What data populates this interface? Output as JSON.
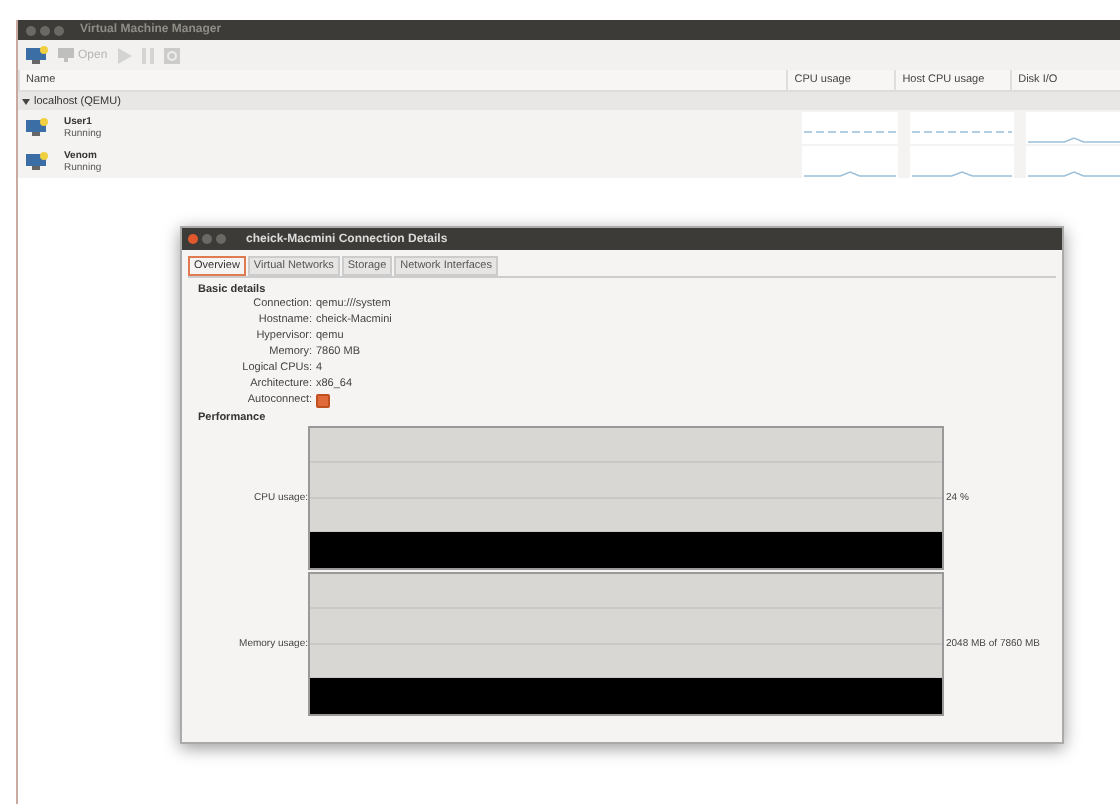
{
  "window": {
    "title": "Virtual Machine Manager"
  },
  "toolbar": [
    {
      "kind": "new",
      "disabled": false
    },
    {
      "kind": "open",
      "label": "Open",
      "disabled": true
    },
    {
      "kind": "run",
      "disabled": true
    },
    {
      "kind": "pause",
      "disabled": true
    },
    {
      "kind": "shutdown",
      "disabled": true
    }
  ],
  "columns": [
    "Name",
    "CPU usage",
    "Host CPU usage",
    "Disk I/O"
  ],
  "groups": [
    {
      "name": "localhost (QEMU)",
      "expanded": true,
      "vms": [
        {
          "name": "User1",
          "status": "Running"
        },
        {
          "name": "Venom",
          "status": "Running"
        }
      ]
    }
  ],
  "dialog": {
    "title": "cheick-Macmini Connection Details",
    "tabs": [
      {
        "label": "Overview",
        "selected": true
      },
      {
        "label": "Virtual Networks",
        "selected": false
      },
      {
        "label": "Storage",
        "selected": false
      },
      {
        "label": "Network Interfaces",
        "selected": false
      }
    ],
    "basic_title": "Basic details",
    "fields": [
      {
        "label": "Connection:",
        "value": "qemu:///system"
      },
      {
        "label": "Hostname:",
        "value": "cheick-Macmini"
      },
      {
        "label": "Hypervisor:",
        "value": "qemu"
      },
      {
        "label": "Memory:",
        "value": "7860 MB"
      },
      {
        "label": "Logical CPUs:",
        "value": "4"
      },
      {
        "label": "Architecture:",
        "value": "x86_64"
      }
    ],
    "autoconnect": {
      "label": "Autoconnect:",
      "checked": true
    },
    "performance_title": "Performance",
    "graphs": [
      {
        "label": "CPU usage:",
        "reading": "24 %"
      },
      {
        "label": "Memory usage:",
        "reading": "2048 MB of 7860 MB"
      }
    ]
  }
}
